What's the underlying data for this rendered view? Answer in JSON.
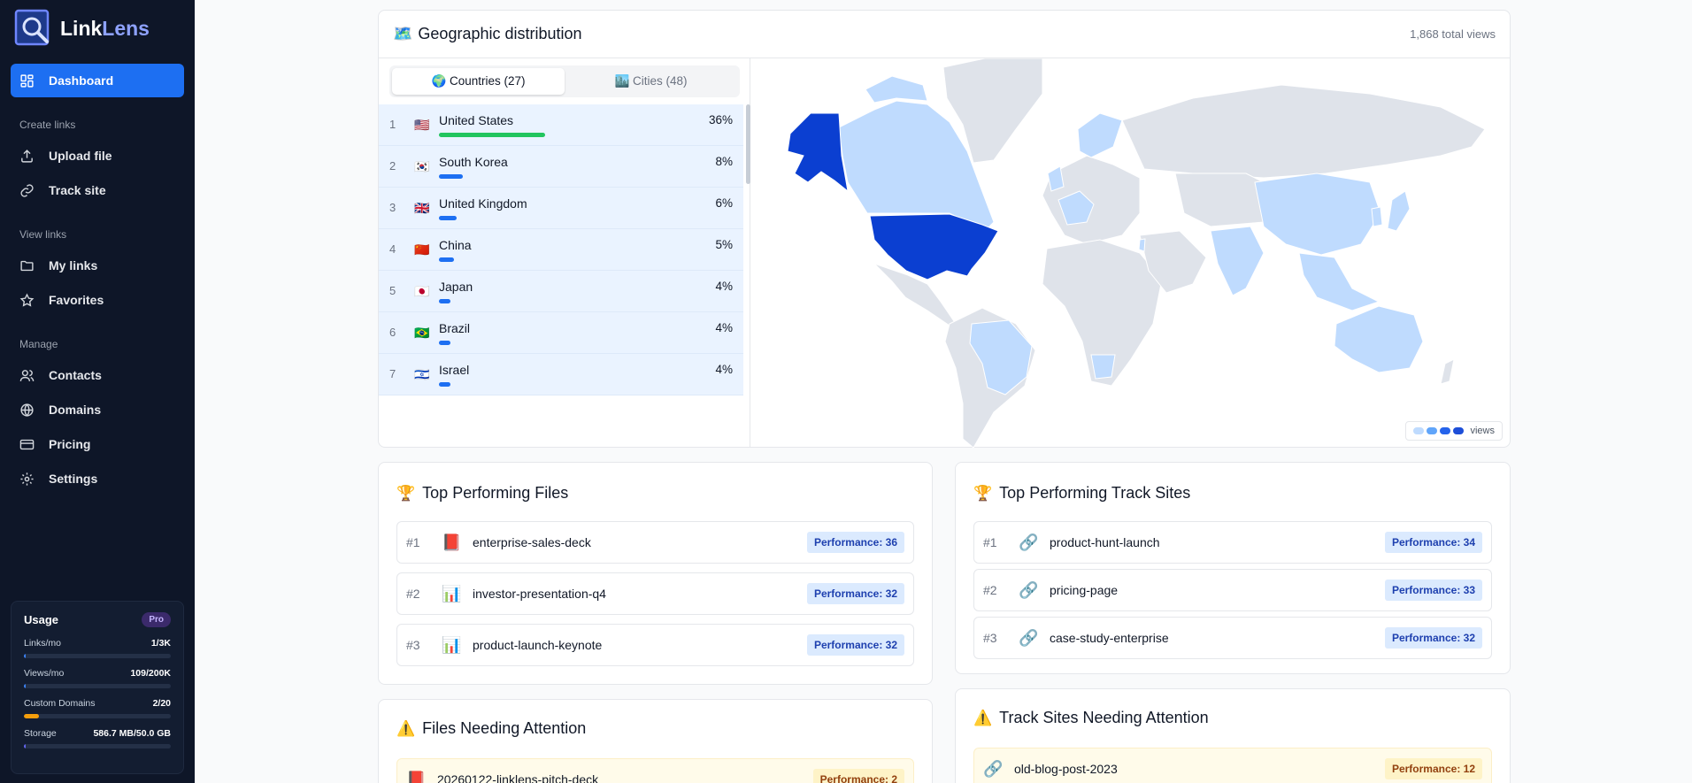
{
  "app": {
    "name_part1": "Link",
    "name_part2": "Lens"
  },
  "sidebar": {
    "dashboard": "Dashboard",
    "sections": {
      "create": "Create links",
      "view": "View links",
      "manage": "Manage"
    },
    "items": {
      "upload": "Upload file",
      "track": "Track site",
      "mylinks": "My links",
      "favorites": "Favorites",
      "contacts": "Contacts",
      "domains": "Domains",
      "pricing": "Pricing",
      "settings": "Settings"
    }
  },
  "usage": {
    "title": "Usage",
    "plan": "Pro",
    "rows": [
      {
        "label": "Links/mo",
        "value": "1/3K",
        "fill": 0.0003,
        "color": "#3b82f6"
      },
      {
        "label": "Views/mo",
        "value": "109/200K",
        "fill": 0.0005,
        "color": "#3b82f6"
      },
      {
        "label": "Custom Domains",
        "value": "2/20",
        "fill": 0.1,
        "color": "#f59e0b"
      },
      {
        "label": "Storage",
        "value": "586.7 MB/50.0 GB",
        "fill": 0.012,
        "color": "#6366f1"
      }
    ]
  },
  "geo": {
    "icon": "🗺️",
    "title": "Geographic distribution",
    "total": "1,868 total views",
    "tab_countries": "🌍 Countries (27)",
    "tab_cities": "🏙️ Cities (48)",
    "legend_label": "views",
    "legend_colors": [
      "#bfdbfe",
      "#60a5fa",
      "#2563eb",
      "#1d4ed8"
    ],
    "countries": [
      {
        "rank": "1",
        "flag": "🇺🇸",
        "name": "United States",
        "pct": "36%",
        "share": 36,
        "bar_color": "#22c55e"
      },
      {
        "rank": "2",
        "flag": "🇰🇷",
        "name": "South Korea",
        "pct": "8%",
        "share": 8,
        "bar_color": "#1d6ff2"
      },
      {
        "rank": "3",
        "flag": "🇬🇧",
        "name": "United Kingdom",
        "pct": "6%",
        "share": 6,
        "bar_color": "#1d6ff2"
      },
      {
        "rank": "4",
        "flag": "🇨🇳",
        "name": "China",
        "pct": "5%",
        "share": 5,
        "bar_color": "#1d6ff2"
      },
      {
        "rank": "5",
        "flag": "🇯🇵",
        "name": "Japan",
        "pct": "4%",
        "share": 4,
        "bar_color": "#1d6ff2"
      },
      {
        "rank": "6",
        "flag": "🇧🇷",
        "name": "Brazil",
        "pct": "4%",
        "share": 4,
        "bar_color": "#1d6ff2"
      },
      {
        "rank": "7",
        "flag": "🇮🇱",
        "name": "Israel",
        "pct": "4%",
        "share": 4,
        "bar_color": "#1d6ff2"
      }
    ]
  },
  "top_files": {
    "icon": "🏆",
    "title": "Top Performing Files",
    "items": [
      {
        "rank": "#1",
        "icon": "📕",
        "name": "enterprise-sales-deck",
        "perf": "Performance: 36"
      },
      {
        "rank": "#2",
        "icon": "📊",
        "name": "investor-presentation-q4",
        "perf": "Performance: 32"
      },
      {
        "rank": "#3",
        "icon": "📊",
        "name": "product-launch-keynote",
        "perf": "Performance: 32"
      }
    ]
  },
  "top_sites": {
    "icon": "🏆",
    "title": "Top Performing Track Sites",
    "items": [
      {
        "rank": "#1",
        "icon": "🔗",
        "name": "product-hunt-launch",
        "perf": "Performance: 34"
      },
      {
        "rank": "#2",
        "icon": "🔗",
        "name": "pricing-page",
        "perf": "Performance: 33"
      },
      {
        "rank": "#3",
        "icon": "🔗",
        "name": "case-study-enterprise",
        "perf": "Performance: 32"
      }
    ]
  },
  "attn_files": {
    "icon": "⚠️",
    "title": "Files Needing Attention",
    "items": [
      {
        "icon": "📕",
        "name": "20260122-linklens-pitch-deck",
        "perf": "Performance: 2"
      }
    ]
  },
  "attn_sites": {
    "icon": "⚠️",
    "title": "Track Sites Needing Attention",
    "items": [
      {
        "icon": "🔗",
        "name": "old-blog-post-2023",
        "perf": "Performance: 12"
      }
    ]
  }
}
